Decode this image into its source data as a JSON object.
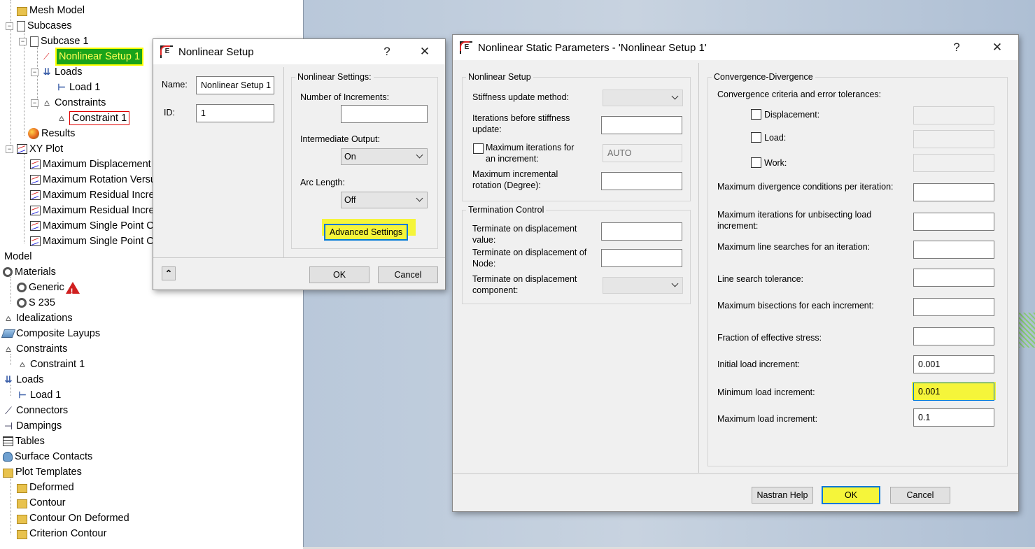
{
  "tree": {
    "top": [
      {
        "label": "Mesh Model",
        "icon": "mesh-model-icon"
      },
      {
        "label": "Subcases",
        "icon": "subcases-icon"
      },
      {
        "label": "Subcase 1",
        "icon": "document-icon"
      },
      {
        "label": "Nonlinear Setup 1",
        "icon": "nonlinear-setup-icon"
      },
      {
        "label": "Loads",
        "icon": "loads-icon"
      },
      {
        "label": "Load 1",
        "icon": "load-icon"
      },
      {
        "label": "Constraints",
        "icon": "constraints-icon"
      },
      {
        "label": "Constraint 1",
        "icon": "constraint-icon"
      },
      {
        "label": "Results",
        "icon": "results-icon"
      },
      {
        "label": "XY Plot",
        "icon": "plot-icon"
      },
      {
        "label": "Maximum Displacement",
        "icon": "plot-icon"
      },
      {
        "label": "Maximum Rotation Versus",
        "icon": "plot-icon"
      },
      {
        "label": "Maximum Residual Increment",
        "icon": "plot-icon"
      },
      {
        "label": "Maximum Residual Increment",
        "icon": "plot-icon"
      },
      {
        "label": "Maximum Single Point Constraint",
        "icon": "plot-icon"
      },
      {
        "label": "Maximum Single Point Constraint",
        "icon": "plot-icon"
      }
    ],
    "model_label": "Model",
    "model": [
      {
        "label": "Materials",
        "icon": "materials-icon"
      },
      {
        "label": "Generic",
        "icon": "material-icon"
      },
      {
        "label": "S 235",
        "icon": "material-icon"
      },
      {
        "label": "Idealizations",
        "icon": "idealizations-icon"
      },
      {
        "label": "Composite Layups",
        "icon": "composite-layups-icon"
      },
      {
        "label": "Constraints",
        "icon": "constraints-icon"
      },
      {
        "label": "Constraint 1",
        "icon": "constraint-icon"
      },
      {
        "label": "Loads",
        "icon": "loads-icon"
      },
      {
        "label": "Load 1",
        "icon": "load-icon"
      },
      {
        "label": "Connectors",
        "icon": "connectors-icon"
      },
      {
        "label": "Dampings",
        "icon": "dampings-icon"
      },
      {
        "label": "Tables",
        "icon": "tables-icon"
      },
      {
        "label": "Surface Contacts",
        "icon": "surface-contacts-icon"
      },
      {
        "label": "Plot Templates",
        "icon": "folder-icon"
      },
      {
        "label": "Deformed",
        "icon": "folder-icon"
      },
      {
        "label": "Contour",
        "icon": "folder-icon"
      },
      {
        "label": "Contour On Deformed",
        "icon": "folder-icon"
      },
      {
        "label": "Criterion Contour",
        "icon": "folder-icon"
      }
    ]
  },
  "setup_dialog": {
    "title": "Nonlinear Setup",
    "help": "?",
    "close": "✕",
    "name_label": "Name:",
    "name_value": "Nonlinear Setup 1",
    "id_label": "ID:",
    "id_value": "1",
    "group_title": "Nonlinear Settings:",
    "increments_label": "Number of Increments:",
    "increments_value": "",
    "output_label": "Intermediate Output:",
    "output_value": "On",
    "arc_label": "Arc Length:",
    "arc_value": "Off",
    "advanced_label": "Advanced Settings",
    "collapse_glyph": "⌃",
    "ok": "OK",
    "cancel": "Cancel"
  },
  "params_dialog": {
    "title": "Nonlinear Static Parameters - 'Nonlinear Setup 1'",
    "help": "?",
    "close": "✕",
    "setup_group": "Nonlinear Setup",
    "stiffness_label": "Stiffness update method:",
    "iter_stiff_label": "Iterations before stiffness update:",
    "max_iter_label": "Maximum iterations for an increment:",
    "max_iter_value": "AUTO",
    "max_rot_label": "Maximum incremental rotation (Degree):",
    "term_group": "Termination Control",
    "term_disp_label": "Terminate on displacement value:",
    "term_node_label": "Terminate on displacement of Node:",
    "term_comp_label": "Terminate on displacement component:",
    "conv_group": "Convergence-Divergence",
    "conv_label": "Convergence criteria and error tolerances:",
    "disp_label": "Displacement:",
    "load_label": "Load:",
    "work_label": "Work:",
    "max_div_label": "Maximum divergence conditions per iteration:",
    "max_unbis_label": "Maximum iterations for unbisecting load increment:",
    "max_ls_label": "Maximum line searches for an iteration:",
    "ls_tol_label": "Line search tolerance:",
    "max_bis_label": "Maximum bisections for each increment:",
    "frac_label": "Fraction of effective stress:",
    "init_load_label": "Initial load increment:",
    "init_load_value": "0.001",
    "min_load_label": "Minimum load increment:",
    "min_load_value": "0.001",
    "max_load_label": "Maximum load increment:",
    "max_load_value": "0.1",
    "nastran_help": "Nastran Help",
    "ok": "OK",
    "cancel": "Cancel"
  },
  "colors": {
    "highlight_yellow": "#f5f53a",
    "tree_highlight_green": "#1aa31a",
    "focus_blue": "#0078d7"
  }
}
